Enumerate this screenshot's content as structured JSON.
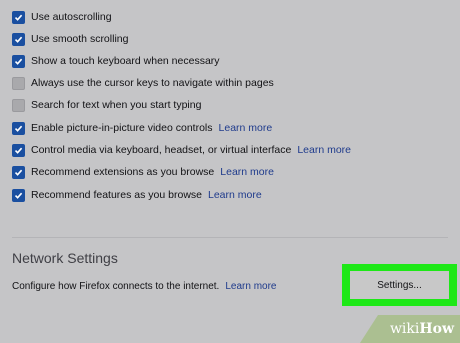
{
  "options": [
    {
      "label": "Use autoscrolling",
      "checked": true,
      "learn_more": ""
    },
    {
      "label": "Use smooth scrolling",
      "checked": true,
      "learn_more": ""
    },
    {
      "label": "Show a touch keyboard when necessary",
      "checked": true,
      "learn_more": ""
    },
    {
      "label": "Always use the cursor keys to navigate within pages",
      "checked": false,
      "learn_more": ""
    },
    {
      "label": "Search for text when you start typing",
      "checked": false,
      "learn_more": ""
    },
    {
      "label": "Enable picture-in-picture video controls",
      "checked": true,
      "learn_more": "Learn more"
    },
    {
      "label": "Control media via keyboard, headset, or virtual interface",
      "checked": true,
      "learn_more": "Learn more"
    },
    {
      "label": "Recommend extensions as you browse",
      "checked": true,
      "learn_more": "Learn more"
    },
    {
      "label": "Recommend features as you browse",
      "checked": true,
      "learn_more": "Learn more"
    }
  ],
  "network": {
    "title": "Network Settings",
    "description": "Configure how Firefox connects to the internet.",
    "learn_more": "Learn more",
    "button_label": "Settings..."
  },
  "watermark": {
    "wiki": "wiki",
    "how": "How"
  },
  "colors": {
    "background": "#c5c5c7",
    "checkbox_checked": "#1a4fa0",
    "link": "#1f3b8c",
    "highlight": "#1ee817"
  }
}
